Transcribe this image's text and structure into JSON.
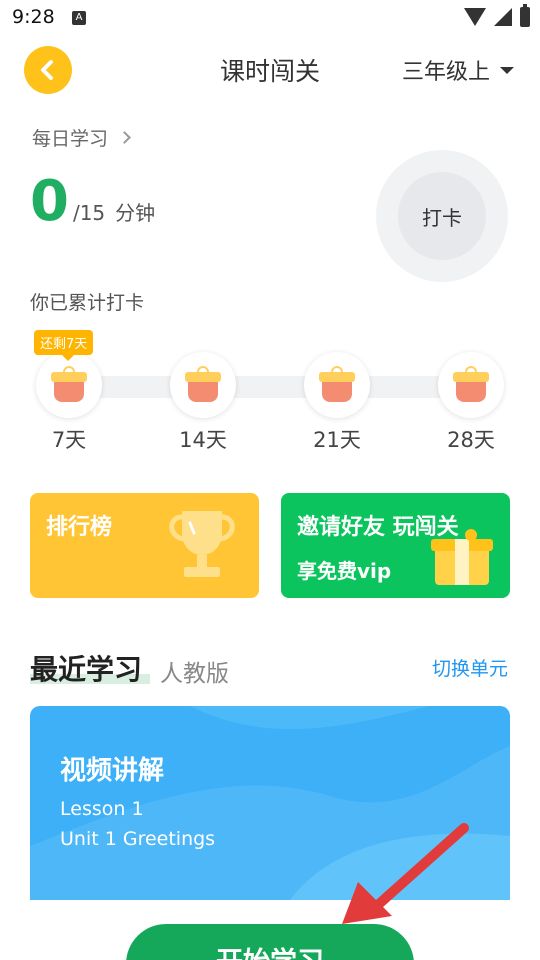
{
  "status_bar": {
    "time": "9:28",
    "notification_glyph": "A",
    "icons": [
      "wifi-icon",
      "signal-icon",
      "battery-icon"
    ]
  },
  "header": {
    "title": "课时闯关",
    "grade": "三年级上",
    "back_icon": "chevron-left-icon"
  },
  "daily": {
    "title": "每日学习",
    "minutes_done": "0",
    "minutes_total": "/15",
    "minutes_unit": "分钟",
    "checkin_label": "打卡",
    "cumulative_label": "你已累计打卡",
    "remaining_badge": "还剩7天",
    "milestones": [
      {
        "label": "7天"
      },
      {
        "label": "14天"
      },
      {
        "label": "21天"
      },
      {
        "label": "28天"
      }
    ]
  },
  "promos": {
    "rank_title": "排行榜",
    "invite_title": "邀请好友 玩闯关",
    "invite_sub": "享免费vip"
  },
  "recent": {
    "title": "最近学习",
    "edition": "人教版",
    "switch_label": "切换单元"
  },
  "lesson": {
    "kind": "视频讲解",
    "lesson_no": "Lesson 1",
    "unit": "Unit 1 Greetings",
    "start_label": "开始学习"
  },
  "colors": {
    "accent_yellow": "#ffc21a",
    "minutes_green": "#1fae62",
    "rank_card": "#ffc534",
    "invite_card": "#0bc45d",
    "lesson_card": "#3db0f7",
    "start_button": "#16a85a",
    "link_blue": "#2196f3",
    "arrow_red": "#e23b3b"
  }
}
